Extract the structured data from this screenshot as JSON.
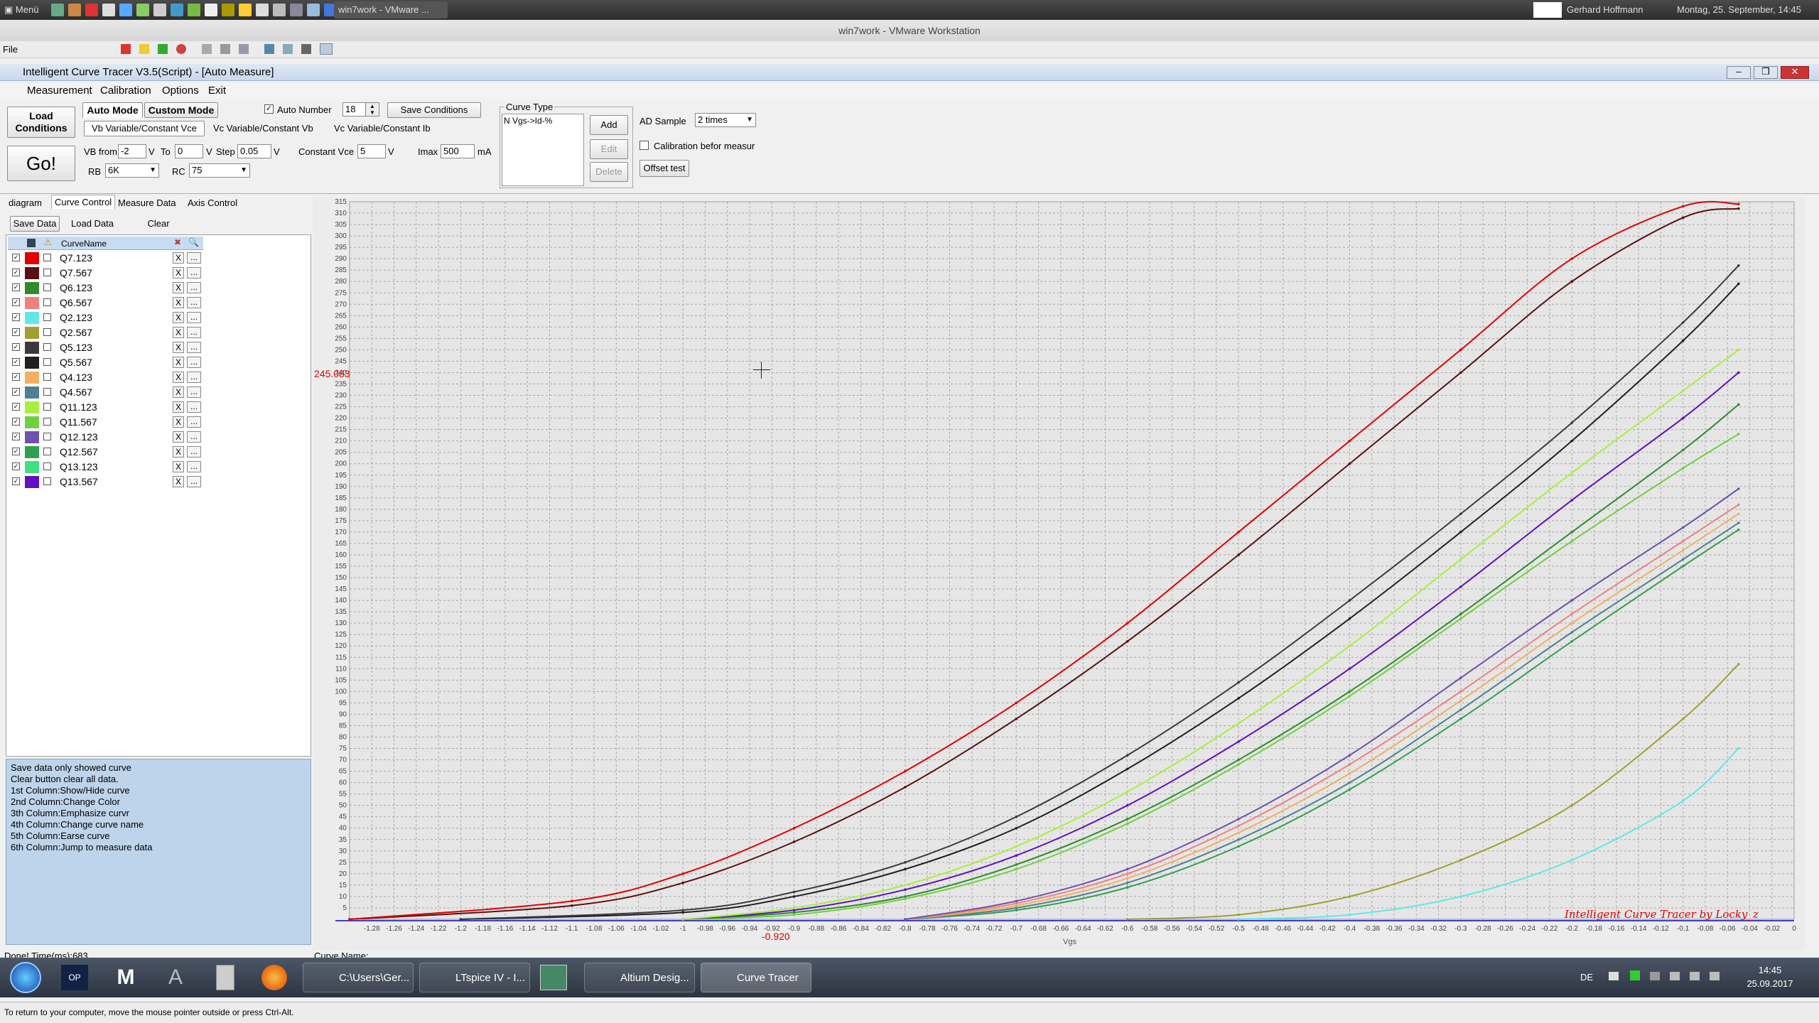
{
  "host": {
    "menu_label": "Menü",
    "vm_tab": "win7work - VMware ...",
    "user": "Gerhard Hoffmann",
    "datetime": "Montag, 25. September, 14:45"
  },
  "vmware": {
    "title": "win7work - VMware Workstation",
    "file_menu": "File"
  },
  "app": {
    "title": "Intelligent Curve Tracer V3.5(Script) - [Auto Measure]",
    "menu": [
      "Measurement",
      "Calibration",
      "Options",
      "Exit"
    ],
    "load_conditions": "Load Conditions",
    "go": "Go!",
    "auto_mode": "Auto Mode",
    "custom_mode": "Custom Mode",
    "auto_number_label": "Auto Number",
    "auto_number_value": "18",
    "save_conditions": "Save Conditions",
    "mode_tabs": [
      "Vb Variable/Constant Vce",
      "Vc Variable/Constant Vb",
      "Vc Variable/Constant Ib"
    ],
    "vb_from_label": "VB from",
    "vb_from": "-2",
    "v1": "V",
    "to_label": "To",
    "to_value": "0",
    "v2": "V",
    "step_label": "Step",
    "step_value": "0.05",
    "v3": "V",
    "const_vce_label": "Constant Vce",
    "const_vce": "5",
    "v4": "V",
    "imax_label": "Imax",
    "imax": "500",
    "ma": "mA",
    "rb_label": "RB",
    "rb": "6K",
    "rc_label": "RC",
    "rc": "75",
    "curve_type_label": "Curve Type",
    "curve_type_item": "N Vgs->Id-%",
    "add": "Add",
    "edit": "Edit",
    "delete": "Delete",
    "ad_sample_label": "AD Sample",
    "ad_sample": "2 times",
    "calib_label": "Calibration befor measur",
    "offset_test": "Offset test",
    "tabs": [
      "diagram",
      "Curve Control",
      "Measure Data",
      "Axis Control"
    ],
    "save_data": "Save Data",
    "load_data": "Load Data",
    "clear": "Clear",
    "col_header": "CurveName",
    "help": [
      "Save data only showed curve",
      "Clear button clear all data.",
      "1st Column:Show/Hide curve",
      "2nd Column:Change Color",
      "3th Column:Emphasize curvr",
      "4th Column:Change curve name",
      "5th Column:Earse curve",
      "6th Column:Jump to measure data"
    ],
    "status": "Done!  Time(ms):683",
    "curve_name_label": "Curve Name:",
    "cursor_y": "245.083",
    "cursor_x": "-0.920",
    "watermark": "Intelligent Curve Tracer by Locky_z",
    "x_axis_label": "Vgs"
  },
  "curves": [
    {
      "name": "Q7.123",
      "color": "#e00000"
    },
    {
      "name": "Q7.567",
      "color": "#5a1010"
    },
    {
      "name": "Q6.123",
      "color": "#2e8b2e"
    },
    {
      "name": "Q6.567",
      "color": "#f08080"
    },
    {
      "name": "Q2.123",
      "color": "#60e8e8"
    },
    {
      "name": "Q2.567",
      "color": "#a0a030"
    },
    {
      "name": "Q5.123",
      "color": "#3a3a3a"
    },
    {
      "name": "Q5.567",
      "color": "#202020"
    },
    {
      "name": "Q4.123",
      "color": "#f0b060"
    },
    {
      "name": "Q4.567",
      "color": "#508090"
    },
    {
      "name": "Q11.123",
      "color": "#a8f040"
    },
    {
      "name": "Q11.567",
      "color": "#70d040"
    },
    {
      "name": "Q12.123",
      "color": "#7050b0"
    },
    {
      "name": "Q12.567",
      "color": "#30a050"
    },
    {
      "name": "Q13.123",
      "color": "#40e080"
    },
    {
      "name": "Q13.567",
      "color": "#6010c0"
    }
  ],
  "taskbar": {
    "items": [
      "C:\\Users\\Ger...",
      "LTspice IV - I...",
      "Altium Desig...",
      "Curve Tracer"
    ],
    "lang": "DE",
    "time": "14:45",
    "date": "25.09.2017"
  },
  "vm_status": "To return to your computer, move the mouse pointer outside or press Ctrl-Alt.",
  "chart_data": {
    "type": "line",
    "xlabel": "Vgs",
    "xlim": [
      -1.3,
      0
    ],
    "ylim": [
      0,
      315
    ],
    "x_ticks": [
      -1.28,
      -1.26,
      -1.24,
      -1.22,
      -1.2,
      -1.18,
      -1.16,
      -1.14,
      -1.12,
      -1.1,
      -1.08,
      -1.06,
      -1.04,
      -1.02,
      -1,
      -0.98,
      -0.96,
      -0.94,
      -0.92,
      -0.9,
      -0.88,
      -0.86,
      -0.84,
      -0.82,
      -0.8,
      -0.78,
      -0.76,
      -0.74,
      -0.72,
      -0.7,
      -0.68,
      -0.66,
      -0.64,
      -0.62,
      -0.6,
      -0.58,
      -0.56,
      -0.54,
      -0.52,
      -0.5,
      -0.48,
      -0.46,
      -0.44,
      -0.42,
      -0.4,
      -0.38,
      -0.36,
      -0.34,
      -0.32,
      -0.3,
      -0.28,
      -0.26,
      -0.24,
      -0.22,
      -0.2,
      -0.18,
      -0.16,
      -0.14,
      -0.12,
      -0.1,
      -0.08,
      -0.06,
      -0.04,
      -0.02,
      0
    ],
    "y_ticks": [
      5,
      10,
      15,
      20,
      25,
      30,
      35,
      40,
      45,
      50,
      55,
      60,
      65,
      70,
      75,
      80,
      85,
      90,
      95,
      100,
      105,
      110,
      115,
      120,
      125,
      130,
      135,
      140,
      145,
      150,
      155,
      160,
      165,
      170,
      175,
      180,
      185,
      190,
      195,
      200,
      205,
      210,
      215,
      220,
      225,
      230,
      235,
      240,
      245,
      250,
      255,
      260,
      265,
      270,
      275,
      280,
      285,
      290,
      295,
      300,
      305,
      310,
      315
    ],
    "series": [
      {
        "name": "Q7.123",
        "color": "#e00000",
        "x": [
          -1.3,
          -1.1,
          -1.0,
          -0.9,
          -0.8,
          -0.7,
          -0.6,
          -0.5,
          -0.4,
          -0.3,
          -0.2,
          -0.1,
          -0.05
        ],
        "y": [
          0,
          8,
          20,
          40,
          65,
          95,
          130,
          170,
          210,
          250,
          290,
          313,
          314
        ]
      },
      {
        "name": "Q7.567",
        "color": "#5a1010",
        "x": [
          -1.3,
          -1.1,
          -1.0,
          -0.9,
          -0.8,
          -0.7,
          -0.6,
          -0.5,
          -0.4,
          -0.3,
          -0.2,
          -0.1,
          -0.05
        ],
        "y": [
          0,
          6,
          16,
          34,
          58,
          88,
          122,
          160,
          200,
          240,
          280,
          308,
          312
        ]
      },
      {
        "name": "Q5.123",
        "color": "#3a3a3a",
        "x": [
          -1.2,
          -1.0,
          -0.9,
          -0.8,
          -0.7,
          -0.6,
          -0.5,
          -0.4,
          -0.3,
          -0.2,
          -0.1,
          -0.05
        ],
        "y": [
          0,
          4,
          12,
          25,
          45,
          72,
          104,
          140,
          178,
          218,
          262,
          287
        ]
      },
      {
        "name": "Q5.567",
        "color": "#202020",
        "x": [
          -1.2,
          -1.0,
          -0.9,
          -0.8,
          -0.7,
          -0.6,
          -0.5,
          -0.4,
          -0.3,
          -0.2,
          -0.1,
          -0.05
        ],
        "y": [
          0,
          3,
          10,
          22,
          40,
          66,
          97,
          132,
          170,
          210,
          254,
          279
        ]
      },
      {
        "name": "Q11.123",
        "color": "#a8f040",
        "x": [
          -1.0,
          -0.9,
          -0.8,
          -0.7,
          -0.6,
          -0.5,
          -0.4,
          -0.3,
          -0.2,
          -0.1,
          -0.05
        ],
        "y": [
          0,
          5,
          15,
          32,
          56,
          86,
          120,
          158,
          196,
          232,
          250
        ]
      },
      {
        "name": "Q13.567",
        "color": "#6010c0",
        "x": [
          -1.0,
          -0.9,
          -0.8,
          -0.7,
          -0.6,
          -0.5,
          -0.4,
          -0.3,
          -0.2,
          -0.1,
          -0.05
        ],
        "y": [
          0,
          4,
          13,
          28,
          50,
          78,
          110,
          146,
          184,
          220,
          240
        ]
      },
      {
        "name": "Q6.123",
        "color": "#2e8b2e",
        "x": [
          -1.0,
          -0.9,
          -0.8,
          -0.7,
          -0.6,
          -0.5,
          -0.4,
          -0.3,
          -0.2,
          -0.1,
          -0.05
        ],
        "y": [
          0,
          3,
          10,
          24,
          44,
          70,
          100,
          134,
          170,
          206,
          226
        ]
      },
      {
        "name": "Q11.567",
        "color": "#70d040",
        "x": [
          -1.0,
          -0.9,
          -0.8,
          -0.7,
          -0.6,
          -0.5,
          -0.4,
          -0.3,
          -0.2,
          -0.1,
          -0.05
        ],
        "y": [
          0,
          2,
          9,
          22,
          42,
          68,
          98,
          132,
          166,
          198,
          213
        ]
      },
      {
        "name": "Q12.123",
        "color": "#7050b0",
        "x": [
          -0.8,
          -0.7,
          -0.6,
          -0.5,
          -0.4,
          -0.3,
          -0.2,
          -0.1,
          -0.05
        ],
        "y": [
          0,
          8,
          22,
          44,
          72,
          106,
          140,
          172,
          189
        ]
      },
      {
        "name": "Q6.567",
        "color": "#f08080",
        "x": [
          -0.8,
          -0.7,
          -0.6,
          -0.5,
          -0.4,
          -0.3,
          -0.2,
          -0.1,
          -0.05
        ],
        "y": [
          0,
          7,
          20,
          41,
          68,
          100,
          134,
          166,
          182
        ]
      },
      {
        "name": "Q4.123",
        "color": "#f0b060",
        "x": [
          -0.8,
          -0.7,
          -0.6,
          -0.5,
          -0.4,
          -0.3,
          -0.2,
          -0.1,
          -0.05
        ],
        "y": [
          0,
          6,
          18,
          38,
          64,
          96,
          130,
          162,
          178
        ]
      },
      {
        "name": "Q4.567",
        "color": "#508090",
        "x": [
          -0.8,
          -0.7,
          -0.6,
          -0.5,
          -0.4,
          -0.3,
          -0.2,
          -0.1,
          -0.05
        ],
        "y": [
          0,
          5,
          16,
          35,
          60,
          92,
          126,
          158,
          174
        ]
      },
      {
        "name": "Q12.567",
        "color": "#30a050",
        "x": [
          -0.8,
          -0.7,
          -0.6,
          -0.5,
          -0.4,
          -0.3,
          -0.2,
          -0.1,
          -0.05
        ],
        "y": [
          0,
          4,
          14,
          32,
          57,
          88,
          122,
          155,
          171
        ]
      },
      {
        "name": "Q2.567",
        "color": "#a0a030",
        "x": [
          -0.6,
          -0.5,
          -0.4,
          -0.3,
          -0.2,
          -0.1,
          -0.05
        ],
        "y": [
          0,
          2,
          10,
          26,
          50,
          88,
          112
        ]
      },
      {
        "name": "Q2.123",
        "color": "#60e8e8",
        "x": [
          -0.5,
          -0.4,
          -0.3,
          -0.2,
          -0.1,
          -0.05
        ],
        "y": [
          0,
          2,
          10,
          26,
          52,
          75
        ]
      }
    ]
  }
}
